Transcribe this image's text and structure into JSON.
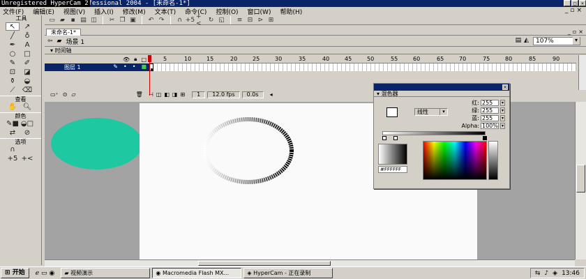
{
  "app": {
    "title": "Macromedia Flash MX Professional 2004 - [未命名-1*]",
    "watermark": "Unregistered HyperCam 2"
  },
  "menu": [
    "文件(F)",
    "编辑(E)",
    "视图(V)",
    "插入(I)",
    "修改(M)",
    "文本(T)",
    "命令(C)",
    "控制(O)",
    "窗口(W)",
    "帮助(H)"
  ],
  "tools": {
    "header": "工具",
    "view_header": "查看",
    "colors_header": "颜色",
    "options_header": "选项"
  },
  "document": {
    "tab": "未命名-1*",
    "scene": "场景 1",
    "zoom": "107%"
  },
  "timeline": {
    "header": "时间轴",
    "layer": "图层 1",
    "ruler": [
      "5",
      "10",
      "15",
      "20",
      "25",
      "30",
      "35",
      "40",
      "45",
      "50",
      "55",
      "60",
      "65",
      "70",
      "75",
      "80",
      "85",
      "90"
    ],
    "current_frame": "1",
    "fps": "12.0 fps",
    "time": "0.0s"
  },
  "mixer": {
    "title": "混色器",
    "fill_type": "线性",
    "red_label": "红:",
    "red": "255",
    "green_label": "绿:",
    "green": "255",
    "blue_label": "蓝:",
    "blue": "255",
    "alpha_label": "Alpha:",
    "alpha": "100%",
    "hex": "#FFFFFF"
  },
  "taskbar": {
    "start": "开始",
    "items": [
      "视频演示",
      "Macromedia Flash MX...",
      "HyperCam - 正在录制"
    ],
    "clock": "13:46"
  },
  "colors": {
    "ellipse_fill": "#1ec8a0",
    "titlebar": "#0a246a"
  }
}
